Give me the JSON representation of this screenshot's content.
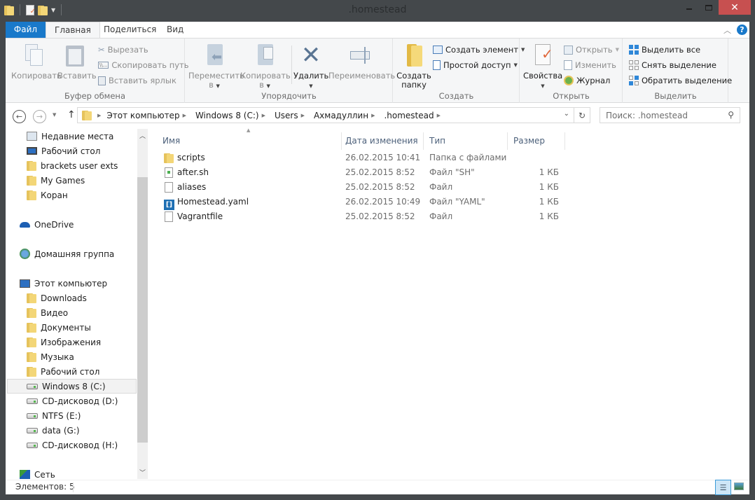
{
  "window": {
    "title": ".homestead",
    "minimize": "—",
    "maximize": "☐",
    "close": "✕"
  },
  "ribbon_tabs": [
    {
      "label": "Файл"
    },
    {
      "label": "Главная"
    },
    {
      "label": "Поделиться"
    },
    {
      "label": "Вид"
    }
  ],
  "ribbon": {
    "clipboard": {
      "group": "Буфер обмена",
      "copy": "Копировать",
      "paste": "Вставить",
      "cut": "Вырезать",
      "copy_path": "Скопировать путь",
      "paste_shortcut": "Вставить ярлык"
    },
    "organize": {
      "group": "Упорядочить",
      "move_to": "Переместить",
      "copy_to": "Копировать",
      "to_suffix": "в",
      "delete": "Удалить",
      "rename": "Переименовать"
    },
    "create": {
      "group": "Создать",
      "new_folder_1": "Создать",
      "new_folder_2": "папку",
      "new_item": "Создать элемент",
      "easy_access": "Простой доступ"
    },
    "open": {
      "group": "Открыть",
      "properties": "Свойства",
      "open": "Открыть",
      "edit": "Изменить",
      "history": "Журнал"
    },
    "select": {
      "group": "Выделить",
      "select_all": "Выделить все",
      "select_none": "Снять выделение",
      "invert": "Обратить выделение"
    }
  },
  "breadcrumb": [
    "Этот компьютер",
    "Windows 8 (C:)",
    "Users",
    "Ахмадуллин",
    ".homestead"
  ],
  "search": {
    "placeholder": "Поиск: .homestead"
  },
  "sidebar": {
    "favorites": [
      "Недавние места",
      "Рабочий стол",
      "brackets user exts",
      "My Games",
      "Коран"
    ],
    "onedrive": "OneDrive",
    "homegroup": "Домашняя группа",
    "computer": "Этот компьютер",
    "computer_items": [
      "Downloads",
      "Видео",
      "Документы",
      "Изображения",
      "Музыка",
      "Рабочий стол",
      "Windows 8 (C:)",
      "CD-дисковод (D:)",
      "NTFS (E:)",
      "data (G:)",
      "CD-дисковод (H:)"
    ],
    "network": "Сеть",
    "selected": "Windows 8 (C:)"
  },
  "columns": {
    "name": "Имя",
    "date": "Дата изменения",
    "type": "Тип",
    "size": "Размер"
  },
  "files": [
    {
      "name": "scripts",
      "date": "26.02.2015 10:41",
      "type": "Папка с файлами",
      "size": "",
      "icon": "folder"
    },
    {
      "name": "after.sh",
      "date": "25.02.2015 8:52",
      "type": "Файл \"SH\"",
      "size": "1 КБ",
      "icon": "script"
    },
    {
      "name": "aliases",
      "date": "25.02.2015 8:52",
      "type": "Файл",
      "size": "1 КБ",
      "icon": "file"
    },
    {
      "name": "Homestead.yaml",
      "date": "26.02.2015 10:49",
      "type": "Файл \"YAML\"",
      "size": "1 КБ",
      "icon": "brackets"
    },
    {
      "name": "Vagrantfile",
      "date": "25.02.2015 8:52",
      "type": "Файл",
      "size": "1 КБ",
      "icon": "file"
    }
  ],
  "status": {
    "count": "Элементов: 5"
  },
  "colors": {
    "accent": "#1979ca",
    "close": "#c75050",
    "chrome": "#44484b"
  }
}
